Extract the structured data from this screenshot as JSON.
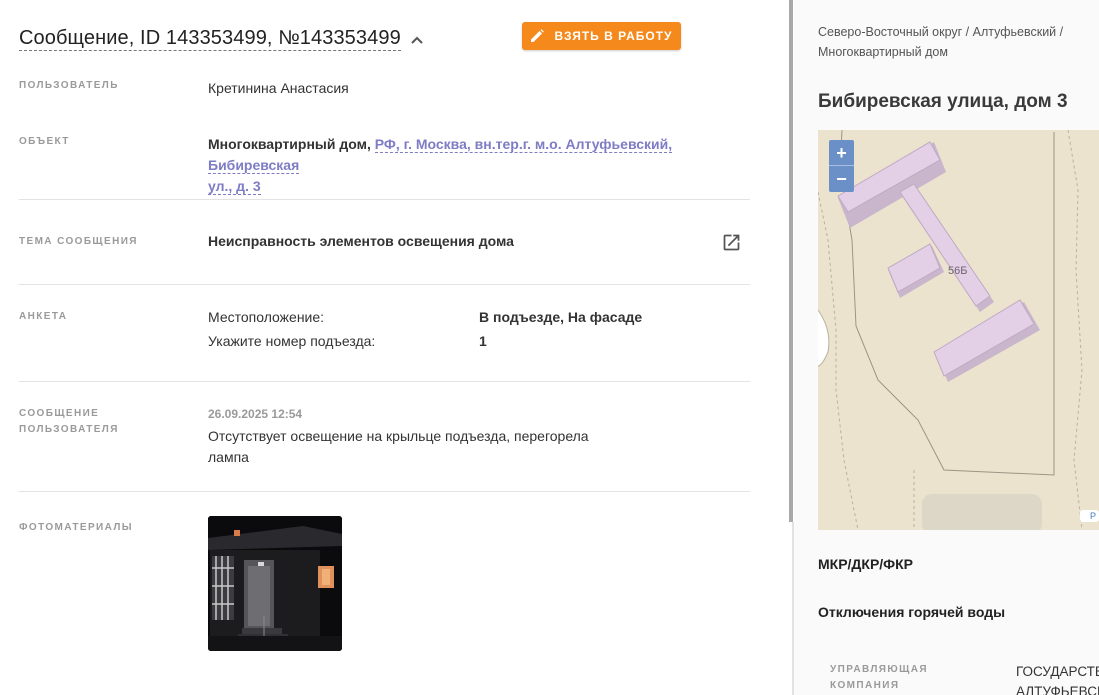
{
  "message": {
    "title": "Сообщение, ID 143353499, №143353499",
    "take_button_label": "ВЗЯТЬ В РАБОТУ"
  },
  "fields": {
    "user_label": "ПОЛЬЗОВАТЕЛЬ",
    "user_value": "Кретинина Анастасия",
    "object_label": "ОБЪЕКТ",
    "object_type": "Многоквартирный дом,",
    "object_address_line1": "РФ, г. Москва, вн.тер.г. м.о. Алтуфьевский, Бибиревская",
    "object_address_line2": "ул., д. 3",
    "topic_label": "ТЕМА СООБЩЕНИЯ",
    "topic_value": "Неисправность элементов освещения дома",
    "form_label": "АНКЕТА",
    "form_rows": [
      {
        "question": "Местоположение:",
        "answer": "В подъезде, На фасаде"
      },
      {
        "question": "Укажите номер подъезда:",
        "answer": "1"
      }
    ],
    "user_message_label_line1": "СООБЩЕНИЕ",
    "user_message_label_line2": "ПОЛЬЗОВАТЕЛЯ",
    "user_message_date": "26.09.2025 12:54",
    "user_message_line1": "Отсутствует освещение на крыльце подъезда, перегорела",
    "user_message_line2": "лампа",
    "photos_label": "ФОТОМАТЕРИАЛЫ"
  },
  "right": {
    "breadcrumb_line1": "Северо-Восточный округ / Алтуфьевский /",
    "breadcrumb_line2": "Многоквартирный дом",
    "address": "Бибиревская улица, дом 3",
    "map_building_label": "56Б",
    "map_zoom_in": "+",
    "map_zoom_out": "−",
    "map_edge_letter": "Р",
    "section_mkr": "МКР/ДКР/ФКР",
    "section_hot_water": "Отключения горячей воды",
    "management_label_line1": "УПРАВЛЯЮЩАЯ",
    "management_label_line2": "КОМПАНИЯ",
    "management_value_line1": "ГОСУДАРСТВ",
    "management_value_line2": "АЛТУФЬЕВСК"
  },
  "colors": {
    "accent_orange": "#f5891b",
    "link_purple": "#7e7cc4",
    "map_building": "#e3cfe6"
  },
  "icons": {
    "chevron": "chevron-up-icon",
    "pencil": "pencil-icon",
    "external": "external-link-icon"
  }
}
